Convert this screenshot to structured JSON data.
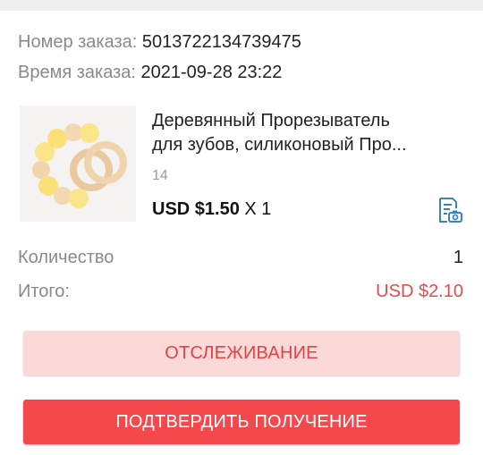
{
  "order": {
    "number_label": "Номер заказа:",
    "number_value": "5013722134739475",
    "time_label": "Время заказа:",
    "time_value": "2021-09-28 23:22"
  },
  "item": {
    "title_line1": "Деревянный Прорезыватель",
    "title_line2": "для зубов, силиконовый Про...",
    "sku": "14",
    "price": "USD $1.50",
    "quantity_text": "X 1",
    "icon": "receipt-camera-icon"
  },
  "summary": {
    "quantity_label": "Количество",
    "quantity_value": "1",
    "total_label": "Итого:",
    "total_value": "USD $2.10"
  },
  "buttons": {
    "track_label": "ОТСЛЕЖИВАНИЕ",
    "confirm_label": "ПОДТВЕРДИТЬ ПОЛУЧЕНИЕ"
  },
  "colors": {
    "accent_red": "#f5484d",
    "accent_light": "#fbd9d9",
    "total_red": "#e84a4a",
    "icon_blue": "#3b82c4"
  }
}
